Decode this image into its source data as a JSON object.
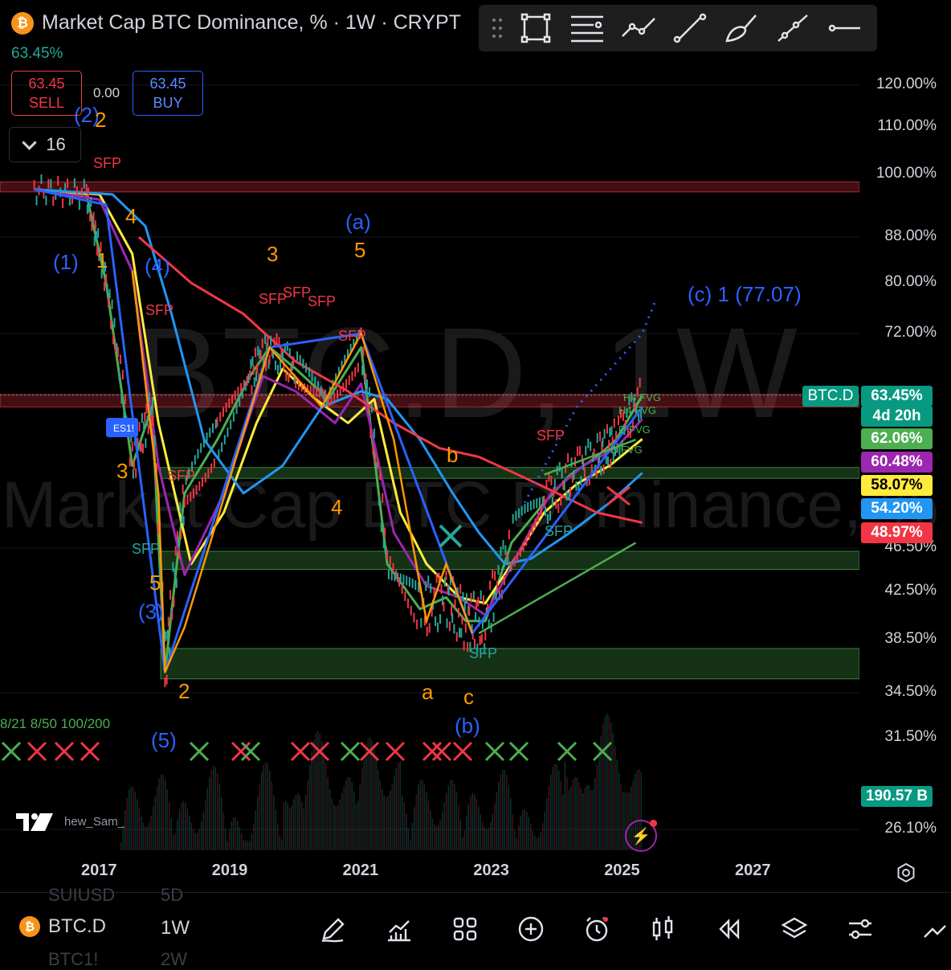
{
  "header": {
    "title": "Market Cap BTC Dominance, % · 1W · CRYPT",
    "last_pct": "63.45%",
    "sell_price": "63.45",
    "sell_label": "SELL",
    "spread": "0.00",
    "buy_price": "63.45",
    "buy_label": "BUY",
    "indicator_count": "16"
  },
  "toolbar": {
    "icons": [
      "drag-handle-icon",
      "rectangle-icon",
      "fib-lines-icon",
      "path-icon",
      "trend-line-icon",
      "brush-icon",
      "ray-icon",
      "horizontal-ray-icon"
    ]
  },
  "watermark": {
    "symbol": "BTC.D, 1W",
    "name": "Market Cap BTC Dominance, %"
  },
  "price_axis": {
    "labels": [
      "120.00%",
      "110.00%",
      "100.00%",
      "88.00%",
      "80.00%",
      "72.00%",
      "46.50%",
      "42.50%",
      "38.50%",
      "34.50%",
      "31.50%",
      "26.10%"
    ]
  },
  "price_tags": [
    {
      "text": "BTC.D",
      "value": "63.45%",
      "color": "#089981"
    },
    {
      "text": "",
      "value": "4d 20h",
      "color": "#089981"
    },
    {
      "text": "",
      "value": "62.06%",
      "color": "#4caf50"
    },
    {
      "text": "",
      "value": "60.48%",
      "color": "#9c27b0"
    },
    {
      "text": "",
      "value": "58.07%",
      "color": "#ffeb3b"
    },
    {
      "text": "",
      "value": "54.20%",
      "color": "#2196f3"
    },
    {
      "text": "",
      "value": "48.97%",
      "color": "#f23645"
    },
    {
      "text": "",
      "value": "190.57 B",
      "color": "#089981"
    }
  ],
  "time_axis": {
    "labels": [
      "2017",
      "2019",
      "2021",
      "2023",
      "2025",
      "2027"
    ]
  },
  "annotations": {
    "wave_labels": [
      "(2)",
      "2",
      "(1)",
      "1",
      "4",
      "(4)",
      "3",
      "(3)",
      "5",
      "2",
      "(5)",
      "3",
      "(a)",
      "5",
      "4",
      "b",
      "a",
      "c",
      "(b)",
      "(c) 1 (77.07)"
    ],
    "sfp_labels": [
      "SFP",
      "SFP",
      "SFP",
      "SFP",
      "SFP",
      "SFP",
      "SFP",
      "SFP",
      "SFP",
      "SFP",
      "SFP"
    ],
    "fvg_labels": [
      "H4 FVG",
      "H4 FVG",
      "D FVG",
      "D FVG"
    ],
    "es_label": "ES1!",
    "ma_cross_labels": "8/21 8/50 100/200",
    "author": "hew_Sam_"
  },
  "chart_data": {
    "type": "line",
    "title": "Market Cap BTC Dominance, % · 1W · CRYPT",
    "xlabel": "",
    "ylabel": "",
    "scale": "log",
    "ylim": [
      26.1,
      120
    ],
    "x_ticks": [
      "2017",
      "2019",
      "2021",
      "2023",
      "2025",
      "2027"
    ],
    "x_range": [
      2016.0,
      2027.6
    ],
    "series": [
      {
        "color": "#4caf50",
        "x": [
          2016.0,
          2016.8,
          2017.1,
          2017.5,
          2017.8,
          2018.0,
          2018.3,
          2018.8,
          2019.3,
          2019.6,
          2020.0,
          2020.5,
          2021.0,
          2021.4,
          2021.9,
          2022.3,
          2022.6,
          2022.9,
          2023.3,
          2023.8,
          2024.2,
          2024.6,
          2024.9,
          2025.3
        ],
        "values": [
          97,
          96,
          80,
          55,
          62,
          36,
          52,
          58,
          66,
          70,
          67,
          63,
          70,
          45,
          41,
          42,
          40,
          40,
          47,
          51,
          54,
          56,
          58,
          63.45
        ]
      },
      {
        "color": "#ffeb3b",
        "x": [
          2016.0,
          2017.0,
          2017.5,
          2017.9,
          2018.4,
          2018.9,
          2019.4,
          2019.8,
          2020.3,
          2020.8,
          2021.2,
          2021.6,
          2022.0,
          2022.5,
          2022.9,
          2023.3,
          2023.8,
          2024.3,
          2024.8,
          2025.3
        ],
        "values": [
          97,
          96,
          85,
          60,
          45,
          50,
          60,
          67,
          63,
          60,
          63,
          50,
          45,
          42,
          41.5,
          45,
          50,
          53,
          55,
          58.07
        ]
      },
      {
        "color": "#9c27b0",
        "x": [
          2016.0,
          2017.0,
          2017.5,
          2017.9,
          2018.3,
          2018.9,
          2019.5,
          2020.0,
          2020.6,
          2021.0,
          2021.5,
          2022.0,
          2022.5,
          2022.9,
          2023.4,
          2023.9,
          2024.4,
          2024.9,
          2025.3
        ],
        "values": [
          97,
          95,
          82,
          55,
          44,
          52,
          66,
          64,
          60,
          65,
          48,
          43,
          42,
          40.5,
          46,
          52,
          55,
          57,
          60.48
        ]
      },
      {
        "color": "#2196f3",
        "x": [
          2016.0,
          2017.2,
          2017.7,
          2018.1,
          2018.6,
          2019.2,
          2019.8,
          2020.4,
          2021.0,
          2021.4,
          2021.9,
          2022.4,
          2022.8,
          2023.2,
          2023.6,
          2024.2,
          2024.8,
          2025.3
        ],
        "values": [
          97,
          96,
          90,
          75,
          58,
          52,
          55,
          62,
          64,
          63,
          58,
          52,
          48,
          45,
          45.5,
          48,
          51,
          54.2
        ]
      },
      {
        "color": "#f23645",
        "x": [
          2017.6,
          2018.4,
          2019.2,
          2020.0,
          2020.8,
          2021.5,
          2022.2,
          2022.8,
          2023.4,
          2024.0,
          2024.6,
          2025.3
        ],
        "values": [
          88,
          80,
          75,
          68,
          64,
          60,
          57,
          56,
          54,
          52,
          50,
          48.97
        ]
      }
    ],
    "horizontal_zones": [
      {
        "from": 96.5,
        "to": 98.5,
        "color": "#f23645"
      },
      {
        "from": 62.0,
        "to": 63.6,
        "color": "#f23645"
      },
      {
        "from": 53.6,
        "to": 54.8,
        "color": "#4caf50"
      },
      {
        "from": 44.5,
        "to": 46.2,
        "color": "#4caf50"
      },
      {
        "from": 35.5,
        "to": 37.8,
        "color": "#4caf50"
      }
    ]
  },
  "bottom": {
    "symbol": "BTC.D",
    "interval": "1W",
    "ghost_top": "SUIUSD",
    "ghost_top_int": "5D",
    "ghost_bottom": "BTC1!",
    "ghost_bottom_int": "2W",
    "icons": [
      "pencil-icon",
      "chart-type-icon",
      "grid-icon",
      "plus-icon",
      "alert-icon",
      "candles-icon",
      "replay-icon",
      "layers-icon",
      "settings-sliders-icon",
      "more-icon"
    ]
  }
}
